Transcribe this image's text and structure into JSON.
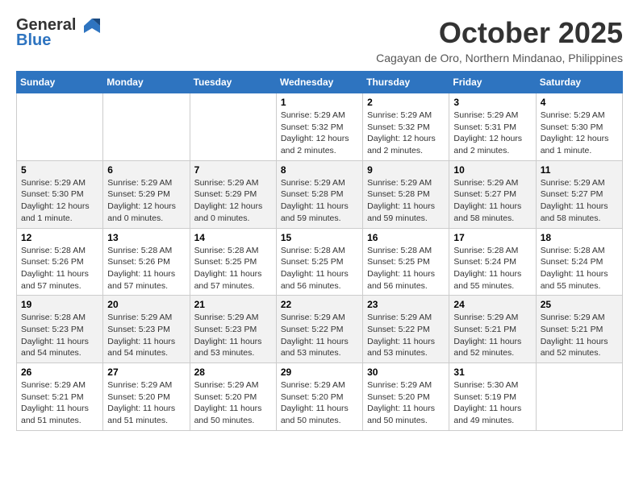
{
  "header": {
    "logo_line1": "General",
    "logo_line2": "Blue",
    "month_title": "October 2025",
    "subtitle": "Cagayan de Oro, Northern Mindanao, Philippines"
  },
  "weekdays": [
    "Sunday",
    "Monday",
    "Tuesday",
    "Wednesday",
    "Thursday",
    "Friday",
    "Saturday"
  ],
  "weeks": [
    [
      {
        "day": "",
        "info": ""
      },
      {
        "day": "",
        "info": ""
      },
      {
        "day": "",
        "info": ""
      },
      {
        "day": "1",
        "info": "Sunrise: 5:29 AM\nSunset: 5:32 PM\nDaylight: 12 hours\nand 2 minutes."
      },
      {
        "day": "2",
        "info": "Sunrise: 5:29 AM\nSunset: 5:32 PM\nDaylight: 12 hours\nand 2 minutes."
      },
      {
        "day": "3",
        "info": "Sunrise: 5:29 AM\nSunset: 5:31 PM\nDaylight: 12 hours\nand 2 minutes."
      },
      {
        "day": "4",
        "info": "Sunrise: 5:29 AM\nSunset: 5:30 PM\nDaylight: 12 hours\nand 1 minute."
      }
    ],
    [
      {
        "day": "5",
        "info": "Sunrise: 5:29 AM\nSunset: 5:30 PM\nDaylight: 12 hours\nand 1 minute."
      },
      {
        "day": "6",
        "info": "Sunrise: 5:29 AM\nSunset: 5:29 PM\nDaylight: 12 hours\nand 0 minutes."
      },
      {
        "day": "7",
        "info": "Sunrise: 5:29 AM\nSunset: 5:29 PM\nDaylight: 12 hours\nand 0 minutes."
      },
      {
        "day": "8",
        "info": "Sunrise: 5:29 AM\nSunset: 5:28 PM\nDaylight: 11 hours\nand 59 minutes."
      },
      {
        "day": "9",
        "info": "Sunrise: 5:29 AM\nSunset: 5:28 PM\nDaylight: 11 hours\nand 59 minutes."
      },
      {
        "day": "10",
        "info": "Sunrise: 5:29 AM\nSunset: 5:27 PM\nDaylight: 11 hours\nand 58 minutes."
      },
      {
        "day": "11",
        "info": "Sunrise: 5:29 AM\nSunset: 5:27 PM\nDaylight: 11 hours\nand 58 minutes."
      }
    ],
    [
      {
        "day": "12",
        "info": "Sunrise: 5:28 AM\nSunset: 5:26 PM\nDaylight: 11 hours\nand 57 minutes."
      },
      {
        "day": "13",
        "info": "Sunrise: 5:28 AM\nSunset: 5:26 PM\nDaylight: 11 hours\nand 57 minutes."
      },
      {
        "day": "14",
        "info": "Sunrise: 5:28 AM\nSunset: 5:25 PM\nDaylight: 11 hours\nand 57 minutes."
      },
      {
        "day": "15",
        "info": "Sunrise: 5:28 AM\nSunset: 5:25 PM\nDaylight: 11 hours\nand 56 minutes."
      },
      {
        "day": "16",
        "info": "Sunrise: 5:28 AM\nSunset: 5:25 PM\nDaylight: 11 hours\nand 56 minutes."
      },
      {
        "day": "17",
        "info": "Sunrise: 5:28 AM\nSunset: 5:24 PM\nDaylight: 11 hours\nand 55 minutes."
      },
      {
        "day": "18",
        "info": "Sunrise: 5:28 AM\nSunset: 5:24 PM\nDaylight: 11 hours\nand 55 minutes."
      }
    ],
    [
      {
        "day": "19",
        "info": "Sunrise: 5:28 AM\nSunset: 5:23 PM\nDaylight: 11 hours\nand 54 minutes."
      },
      {
        "day": "20",
        "info": "Sunrise: 5:29 AM\nSunset: 5:23 PM\nDaylight: 11 hours\nand 54 minutes."
      },
      {
        "day": "21",
        "info": "Sunrise: 5:29 AM\nSunset: 5:23 PM\nDaylight: 11 hours\nand 53 minutes."
      },
      {
        "day": "22",
        "info": "Sunrise: 5:29 AM\nSunset: 5:22 PM\nDaylight: 11 hours\nand 53 minutes."
      },
      {
        "day": "23",
        "info": "Sunrise: 5:29 AM\nSunset: 5:22 PM\nDaylight: 11 hours\nand 53 minutes."
      },
      {
        "day": "24",
        "info": "Sunrise: 5:29 AM\nSunset: 5:21 PM\nDaylight: 11 hours\nand 52 minutes."
      },
      {
        "day": "25",
        "info": "Sunrise: 5:29 AM\nSunset: 5:21 PM\nDaylight: 11 hours\nand 52 minutes."
      }
    ],
    [
      {
        "day": "26",
        "info": "Sunrise: 5:29 AM\nSunset: 5:21 PM\nDaylight: 11 hours\nand 51 minutes."
      },
      {
        "day": "27",
        "info": "Sunrise: 5:29 AM\nSunset: 5:20 PM\nDaylight: 11 hours\nand 51 minutes."
      },
      {
        "day": "28",
        "info": "Sunrise: 5:29 AM\nSunset: 5:20 PM\nDaylight: 11 hours\nand 50 minutes."
      },
      {
        "day": "29",
        "info": "Sunrise: 5:29 AM\nSunset: 5:20 PM\nDaylight: 11 hours\nand 50 minutes."
      },
      {
        "day": "30",
        "info": "Sunrise: 5:29 AM\nSunset: 5:20 PM\nDaylight: 11 hours\nand 50 minutes."
      },
      {
        "day": "31",
        "info": "Sunrise: 5:30 AM\nSunset: 5:19 PM\nDaylight: 11 hours\nand 49 minutes."
      },
      {
        "day": "",
        "info": ""
      }
    ]
  ]
}
